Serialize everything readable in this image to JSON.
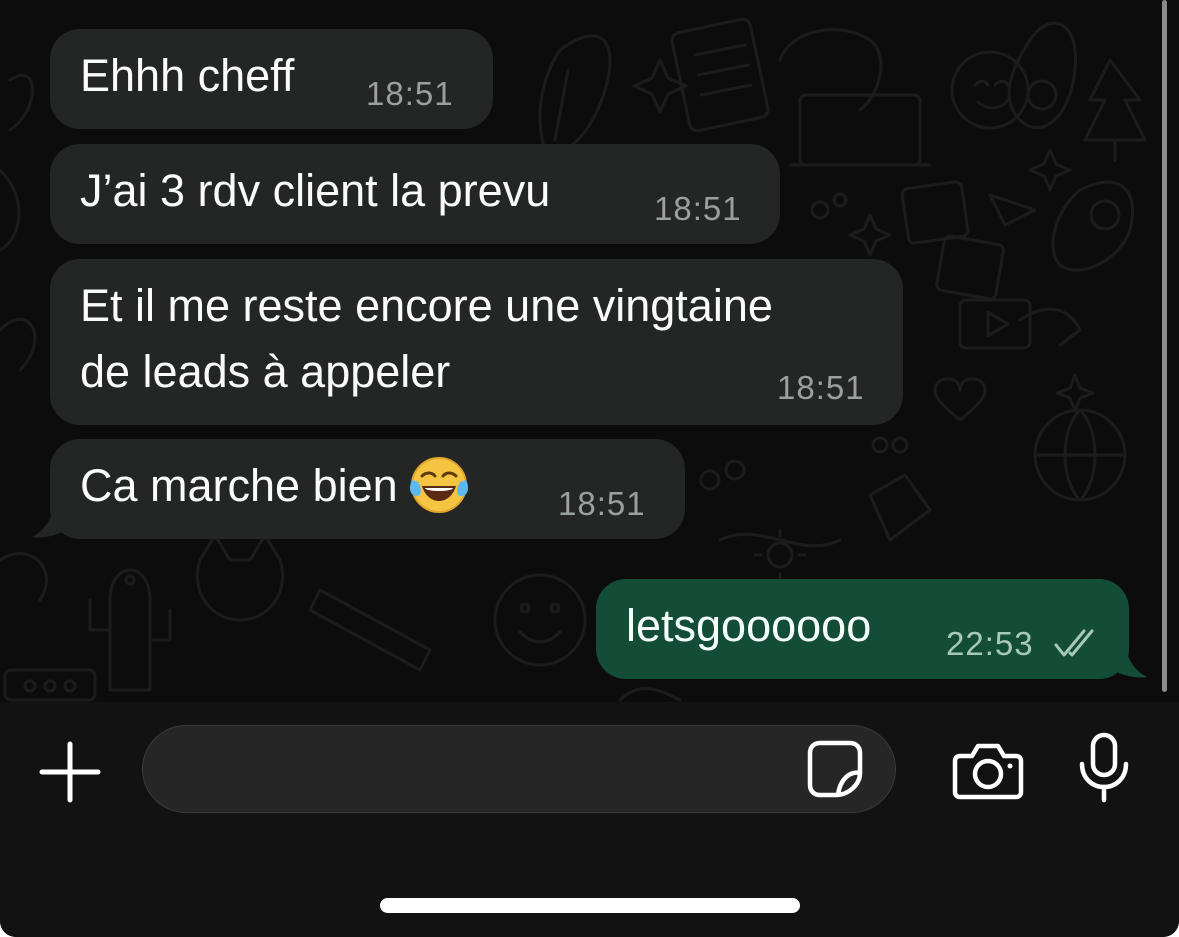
{
  "conversation": {
    "incoming": [
      {
        "lines": [
          "Ehhh cheff"
        ],
        "time": "18:51"
      },
      {
        "lines": [
          "J’ai 3 rdv client la prevu"
        ],
        "time": "18:51"
      },
      {
        "lines": [
          "Et il me reste encore une vingtaine",
          "de leads à appeler"
        ],
        "time": "18:51"
      },
      {
        "lines": [
          "Ca marche bien"
        ],
        "emoji": "face-with-tears-of-joy",
        "time": "18:51"
      }
    ],
    "outgoing": [
      {
        "lines": [
          "letsgoooooo"
        ],
        "time": "22:53",
        "status": "read-double-check"
      }
    ]
  },
  "composer": {
    "placeholder": "",
    "value": "",
    "icons": {
      "add": "plus-icon",
      "sticker": "sticker-icon",
      "camera": "camera-icon",
      "microphone": "microphone-icon"
    }
  },
  "colors": {
    "chat_background": "#0c0c0c",
    "incoming_bubble": "#242626",
    "outgoing_bubble": "#144d37",
    "composer_background": "#121212",
    "input_background": "#262626",
    "timestamp_incoming": "#9aa0a0",
    "timestamp_outgoing": "#a9c9b8"
  }
}
